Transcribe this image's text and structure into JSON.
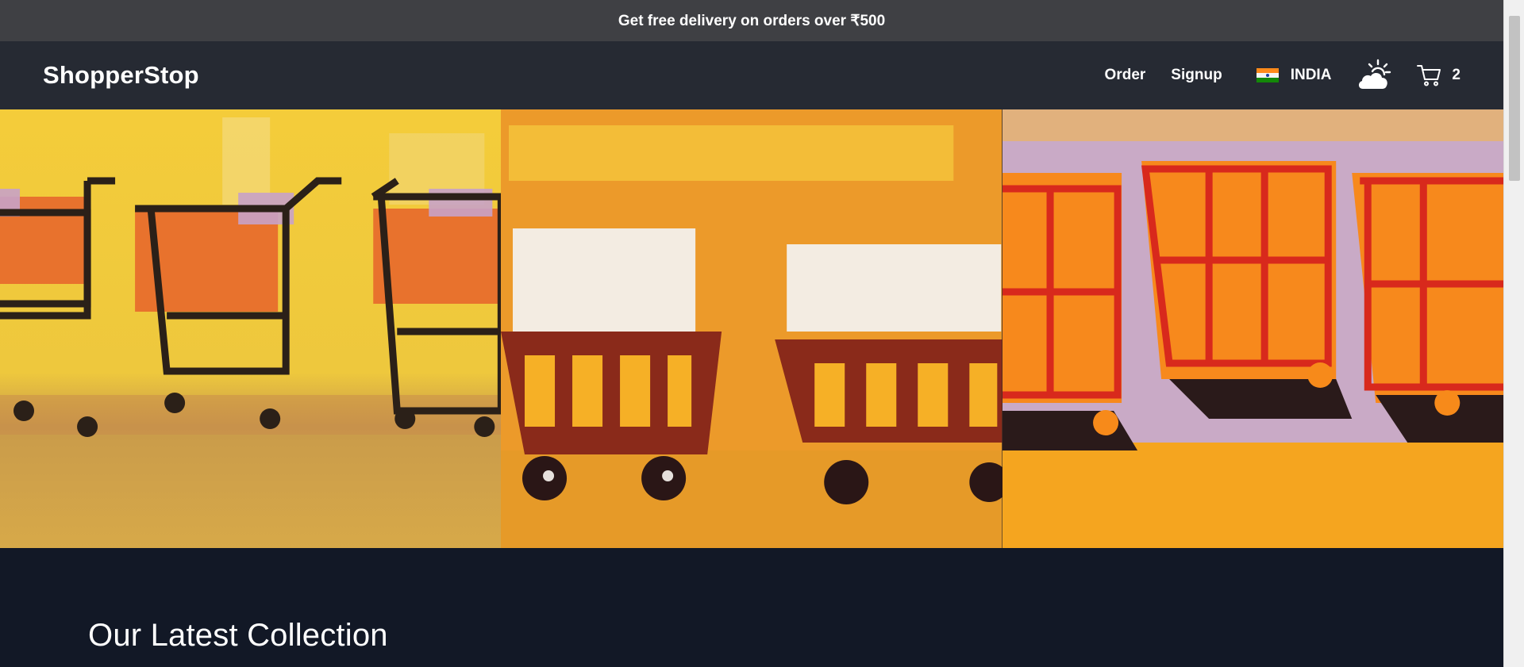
{
  "promo": {
    "text": "Get free delivery on orders over ₹500"
  },
  "nav": {
    "logo": "ShopperStop",
    "links": [
      "Order",
      "Signup"
    ],
    "country": "INDIA",
    "cart_count": "2",
    "icons": {
      "flag": "india-flag-icon",
      "weather": "weather-partly-sunny-icon",
      "cart": "cart-icon"
    }
  },
  "hero": {
    "panels": [
      "painted-shopping-carts-yellow",
      "painted-shopping-carts-orange",
      "painted-delivery-trucks-orange"
    ]
  },
  "section": {
    "title": "Our Latest Collection"
  },
  "colors": {
    "promo_bg": "#3f4044",
    "nav_bg": "#262a33",
    "page_bg": "#121826",
    "accent": "#e0317a"
  }
}
